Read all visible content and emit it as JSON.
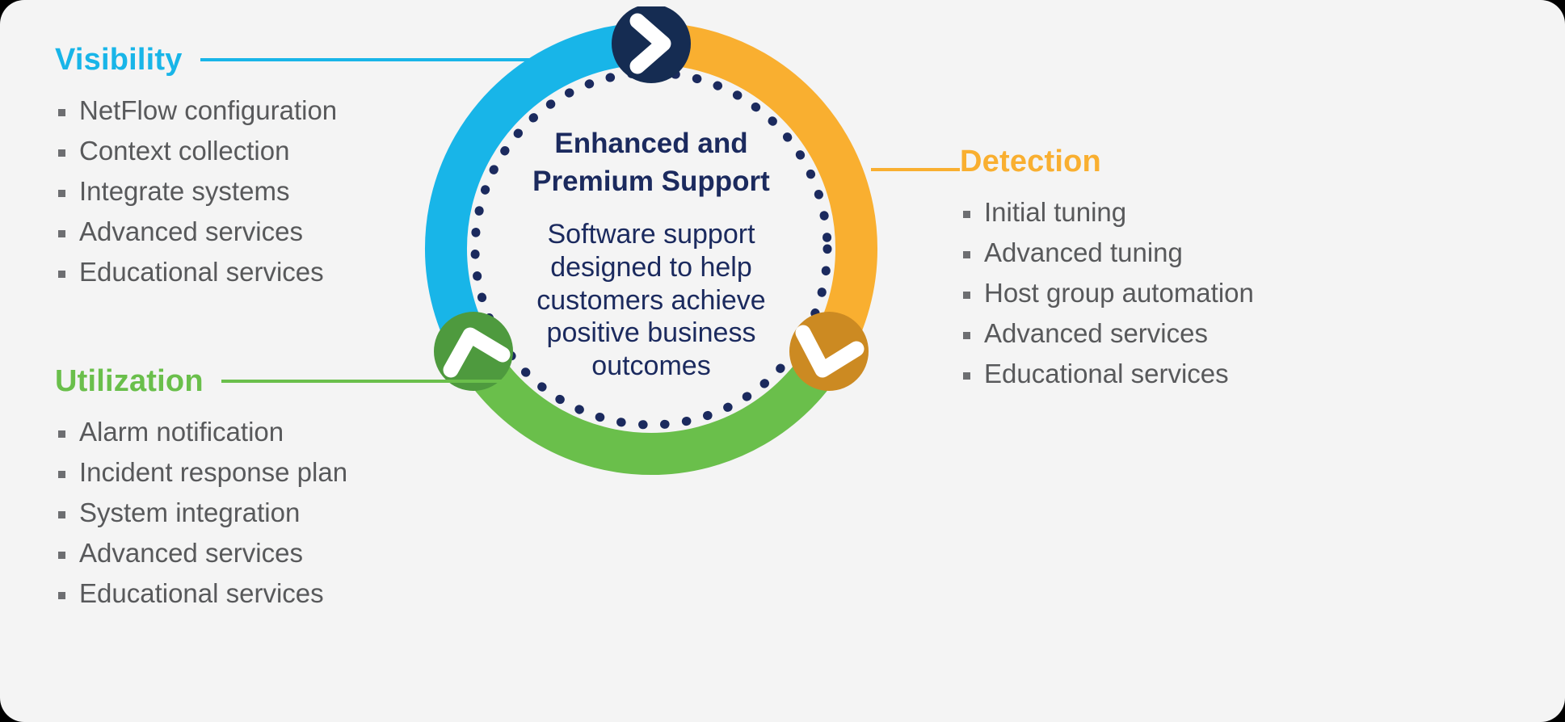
{
  "theme": {
    "background": "#F4F4F4",
    "cyan": "#18B5E8",
    "orange": "#F9AF30",
    "green": "#6ABF4B",
    "navy": "#1B2A5E",
    "body_text": "#58595B",
    "icon_green": "#4E9A3E",
    "icon_orange": "#CC8A22"
  },
  "center": {
    "title_line1": "Enhanced and",
    "title_line2": "Premium Support",
    "body": "Software support designed to help customers achieve positive business outcomes"
  },
  "sections": {
    "visibility": {
      "heading": "Visibility",
      "color": "#18B5E8",
      "items": [
        "NetFlow configuration",
        "Context collection",
        "Integrate systems",
        "Advanced services",
        "Educational services"
      ]
    },
    "detection": {
      "heading": "Detection",
      "color": "#F9AF30",
      "items": [
        "Initial tuning",
        "Advanced tuning",
        "Host group automation",
        "Advanced services",
        "Educational services"
      ]
    },
    "utilization": {
      "heading": "Utilization",
      "color": "#6ABF4B",
      "items": [
        "Alarm notification",
        "Incident response plan",
        "System integration",
        "Advanced services",
        "Educational services"
      ]
    }
  },
  "icons": {
    "top": "chevron-right-icon",
    "bottom_left": "chevron-up-right-icon",
    "bottom_right": "chevron-down-right-icon"
  }
}
